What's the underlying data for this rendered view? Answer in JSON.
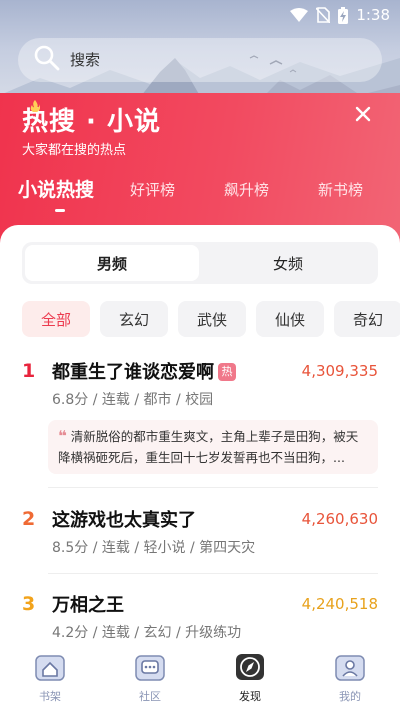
{
  "status_bar": {
    "time": "1:38"
  },
  "search": {
    "placeholder": "搜索"
  },
  "header": {
    "title": "热搜 · 小说",
    "subtitle": "大家都在搜的热点",
    "tabs": [
      {
        "label": "小说热搜",
        "active": true
      },
      {
        "label": "好评榜",
        "active": false
      },
      {
        "label": "飙升榜",
        "active": false
      },
      {
        "label": "新书榜",
        "active": false
      }
    ]
  },
  "gender": {
    "options": [
      "男频",
      "女频"
    ],
    "selected": "男频"
  },
  "categories": [
    "全部",
    "玄幻",
    "武侠",
    "仙侠",
    "奇幻"
  ],
  "selected_category": "全部",
  "rankings": [
    {
      "rank": "1",
      "title": "都重生了谁谈恋爱啊",
      "badge": "热",
      "count": "4,309,335",
      "meta": "6.8分 / 连载 / 都市 / 校园",
      "quote_mark": "❝",
      "description": "清新脱俗的都市重生爽文，主角上辈子是田狗，被天降横祸砸死后，重生回十七岁发誓再也不当田狗，..."
    },
    {
      "rank": "2",
      "title": "这游戏也太真实了",
      "count": "4,260,630",
      "meta": "8.5分 / 连载 / 轻小说 / 第四天灾"
    },
    {
      "rank": "3",
      "title": "万相之王",
      "count": "4,240,518",
      "meta": "4.2分 / 连载 / 玄幻 / 升级练功"
    }
  ],
  "colors": {
    "accent": "#f0334d",
    "rank1": "#e8243d",
    "rank2": "#ef6a34",
    "rank3": "#f2a31b",
    "count": "#e8543a"
  },
  "bottom_nav": [
    {
      "label": "书架",
      "icon": "bookshelf-icon"
    },
    {
      "label": "社区",
      "icon": "community-icon"
    },
    {
      "label": "发现",
      "icon": "discover-icon",
      "active": true
    },
    {
      "label": "我的",
      "icon": "profile-icon"
    }
  ]
}
